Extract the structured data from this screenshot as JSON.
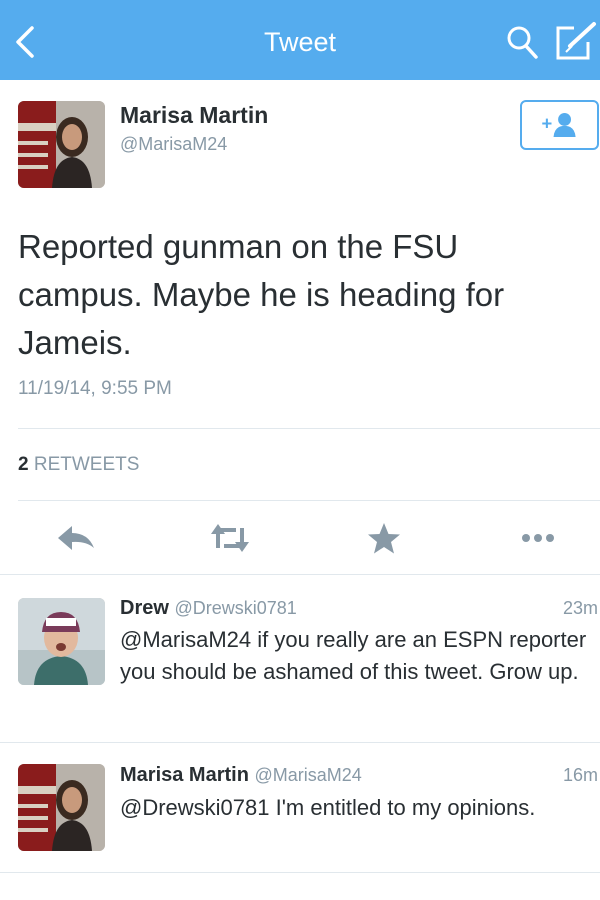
{
  "navbar": {
    "title": "Tweet",
    "back_icon": "chevron-left-icon",
    "search_icon": "search-icon",
    "compose_icon": "compose-icon",
    "bg_color": "#55acee"
  },
  "tweet": {
    "author_name": "Marisa Martin",
    "author_handle": "@MarisaM24",
    "follow_icon": "add-user-icon",
    "text": "Reported gunman on the FSU campus. Maybe he is heading for Jameis.",
    "timestamp": "11/19/14, 9:55 PM",
    "retweet_count": "2",
    "retweet_label": "RETWEETS",
    "actions": [
      "reply-icon",
      "retweet-icon",
      "favorite-icon",
      "more-icon"
    ]
  },
  "replies": [
    {
      "name": "Drew",
      "handle": "@Drewski0781",
      "time": "23m",
      "text": "@MarisaM24 if you really are an ESPN reporter you should be ashamed of this tweet. Grow up."
    },
    {
      "name": "Marisa Martin",
      "handle": "@MarisaM24",
      "time": "16m",
      "text": "@Drewski0781 I'm entitled to my opinions."
    }
  ]
}
